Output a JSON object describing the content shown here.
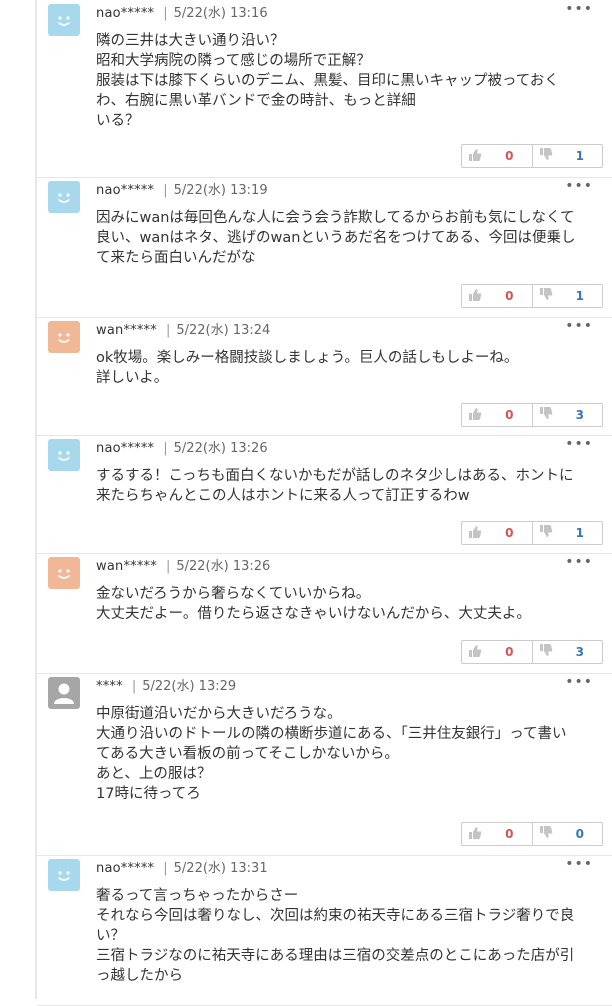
{
  "comments": [
    {
      "user": "nao*****",
      "time": "5/22(水) 13:16",
      "avatar": "smile-blue",
      "lines": [
        "隣の三井は大きい通り沿い？",
        "昭和大学病院の隣って感じの場所で正解？",
        "服装は下は膝下くらいのデニム、黒髪、目印に黒いキャップ被っておく",
        "わ、右腕に黒い革バンドで金の時計、もっと詳細",
        "いる？"
      ],
      "good": "0",
      "bad": "1"
    },
    {
      "user": "nao*****",
      "time": "5/22(水) 13:19",
      "avatar": "smile-blue",
      "lines": [
        "因みにwanは毎回色んな人に会う会う詐欺してるからお前も気にしなくて",
        "良い、wanはネタ、逃げのwanというあだ名をつけてある、今回は便乗し",
        "て来たら面白いんだがな"
      ],
      "good": "0",
      "bad": "1"
    },
    {
      "user": "wan*****",
      "time": "5/22(水) 13:24",
      "avatar": "smile-orange",
      "lines": [
        "ok牧場。楽しみー格闘技談しましょう。巨人の話しもしよーね。",
        "詳しいよ。"
      ],
      "good": "0",
      "bad": "3"
    },
    {
      "user": "nao*****",
      "time": "5/22(水) 13:26",
      "avatar": "smile-blue",
      "lines": [
        "するする！こっちも面白くないかもだが話しのネタ少しはある、ホントに",
        "来たらちゃんとこの人はホントに来る人って訂正するわw"
      ],
      "good": "0",
      "bad": "1"
    },
    {
      "user": "wan*****",
      "time": "5/22(水) 13:26",
      "avatar": "smile-orange",
      "lines": [
        "金ないだろうから奢らなくていいからね。",
        "大丈夫だよー。借りたら返さなきゃいけないんだから、大丈夫よ。"
      ],
      "good": "0",
      "bad": "3"
    },
    {
      "user": "****",
      "time": "5/22(水) 13:29",
      "avatar": "person-gray",
      "lines": [
        "中原街道沿いだから大きいだろうな。",
        "大通り沿いのドトールの隣の横断歩道にある、「三井住友銀行」って書い",
        "てある大きい看板の前ってそこしかないから。",
        "あと、上の服は？",
        "17時に待ってろ"
      ],
      "good": "0",
      "bad": "0"
    },
    {
      "user": "nao*****",
      "time": "5/22(水) 13:31",
      "avatar": "smile-blue",
      "lines": [
        "奢るって言っちゃったからさー",
        "それなら今回は奢りなし、次回は約束の祐天寺にある三宿トラジ奢りで良",
        "い？",
        "三宿トラジなのに祐天寺にある理由は三宿の交差点のとこにあった店が引",
        "っ越したから"
      ],
      "good": "",
      "bad": ""
    }
  ],
  "ui": {
    "separator": "|",
    "more": "•••",
    "colors": {
      "good": "#d9534f",
      "bad": "#3a76b6",
      "blue_avatar": "#a8d8ec",
      "orange_avatar": "#f0b896",
      "gray_avatar": "#a6a6a6"
    }
  }
}
